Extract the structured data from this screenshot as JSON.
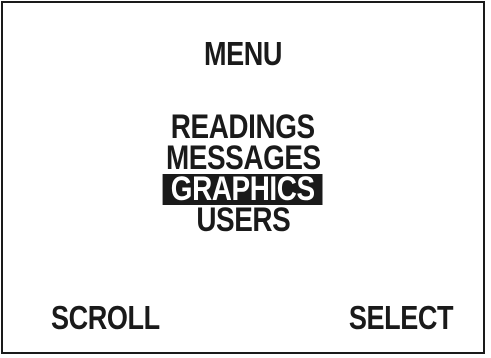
{
  "screen": {
    "title": "MENU",
    "menu_items": [
      {
        "label": "READINGS",
        "selected": false
      },
      {
        "label": "MESSAGES",
        "selected": false
      },
      {
        "label": "GRAPHICS",
        "selected": true
      },
      {
        "label": "USERS",
        "selected": false
      }
    ],
    "softkeys": {
      "left": "SCROLL",
      "right": "SELECT"
    }
  },
  "colors": {
    "foreground": "#1a1a1a",
    "background": "#ffffff",
    "highlight_text": "#ffffff"
  }
}
